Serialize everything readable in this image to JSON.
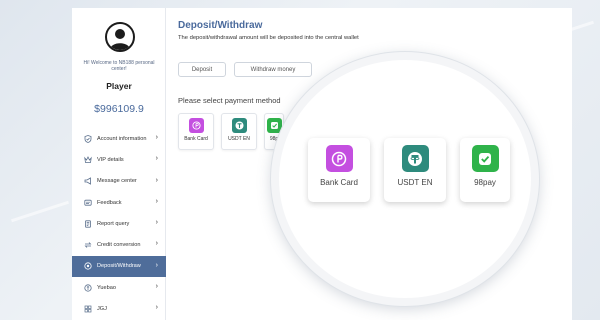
{
  "sidebar": {
    "welcome_text": "Hi! Welcome to NB188 personal center!",
    "username": "Player",
    "balance": "$996109.9",
    "items": [
      {
        "label": "Account information",
        "icon": "shield-icon"
      },
      {
        "label": "VIP details",
        "icon": "crown-icon"
      },
      {
        "label": "Message center",
        "icon": "megaphone-icon"
      },
      {
        "label": "Feedback",
        "icon": "feedback-icon"
      },
      {
        "label": "Report query",
        "icon": "report-icon"
      },
      {
        "label": "Credit conversion",
        "icon": "conversion-icon"
      },
      {
        "label": "Deposit/Withdraw",
        "icon": "wallet-icon",
        "active": true
      },
      {
        "label": "Yuebao",
        "icon": "yuebao-icon"
      },
      {
        "label": "JGJ",
        "icon": "grid-icon"
      }
    ]
  },
  "main": {
    "title": "Deposit/Withdraw",
    "subtitle": "The deposit/withdrawal amount will be deposited into the central wallet",
    "tabs": [
      {
        "label": "Deposit"
      },
      {
        "label": "Withdraw money"
      }
    ],
    "section_label": "Please select payment method",
    "payment_methods_small": [
      {
        "label": "Bank Card",
        "icon": "bank-card-icon",
        "color": "#c44fe0"
      },
      {
        "label": "USDT EN",
        "icon": "usdt-icon",
        "color": "#2e8b7d"
      },
      {
        "label": "98p",
        "icon": "98pay-icon",
        "color": "#2fb34a"
      }
    ]
  },
  "magnifier": {
    "payment_methods": [
      {
        "label": "Bank Card",
        "icon": "bank-card-icon",
        "color": "#c44fe0"
      },
      {
        "label": "USDT EN",
        "icon": "usdt-icon",
        "color": "#2e8b7d"
      },
      {
        "label": "98pay",
        "icon": "98pay-icon",
        "color": "#2fb34a"
      }
    ]
  },
  "colors": {
    "accent": "#4a6a9c",
    "active_menu": "#4f6d9a"
  }
}
